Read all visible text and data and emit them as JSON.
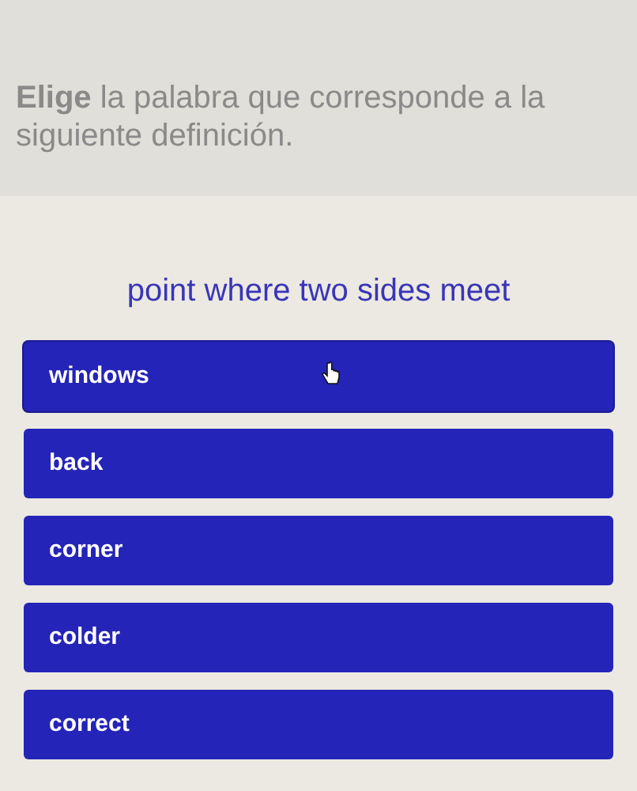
{
  "instruction": "**Elige** la palabra que corresponde a la siguiente definición.",
  "definition": "point where two sides meet",
  "options": [
    {
      "label": "windows",
      "hovered": true
    },
    {
      "label": "back",
      "hovered": false
    },
    {
      "label": "corner",
      "hovered": false
    },
    {
      "label": "colder",
      "hovered": false
    },
    {
      "label": "correct",
      "hovered": false
    }
  ]
}
